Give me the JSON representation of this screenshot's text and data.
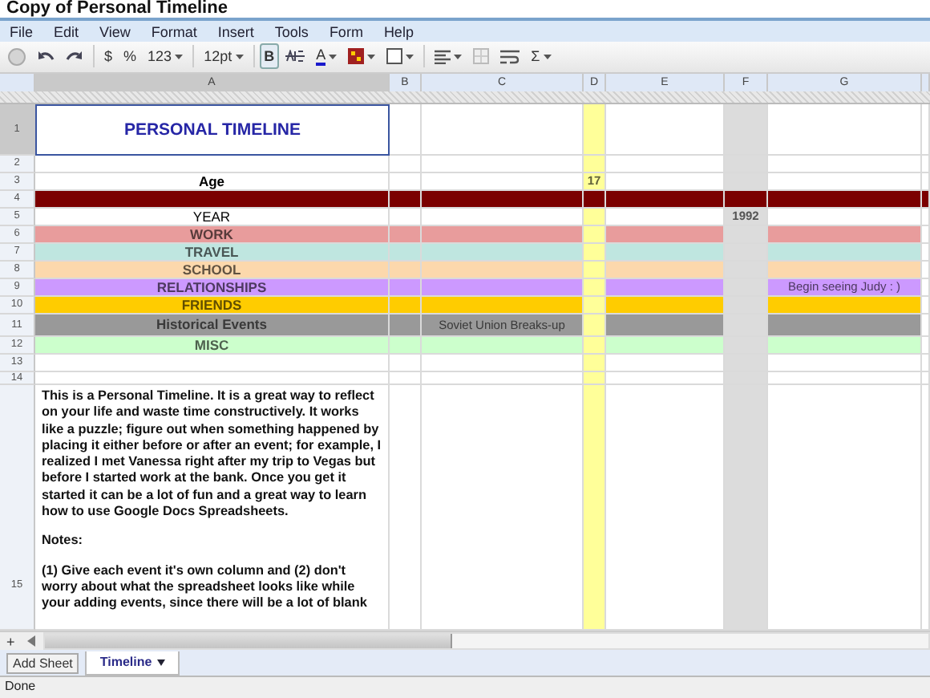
{
  "window": {
    "title": "Copy of Personal Timeline"
  },
  "menu": [
    "File",
    "Edit",
    "View",
    "Format",
    "Insert",
    "Tools",
    "Form",
    "Help"
  ],
  "toolbar": [
    {
      "kind": "print",
      "has_menu": false
    },
    {
      "kind": "undo",
      "has_menu": false
    },
    {
      "kind": "redo",
      "has_menu": false
    },
    {
      "kind": "text",
      "label": "$",
      "has_menu": false,
      "selected": false
    },
    {
      "kind": "text",
      "label": "%",
      "has_menu": false,
      "selected": false
    },
    {
      "kind": "text",
      "label": "123",
      "has_menu": true,
      "selected": false
    },
    {
      "kind": "text",
      "label": "12pt",
      "has_menu": true,
      "selected": false
    },
    {
      "kind": "text",
      "label": "B",
      "has_menu": false,
      "selected": true
    },
    {
      "kind": "strike",
      "has_menu": false
    },
    {
      "kind": "text-color",
      "label": "A",
      "has_menu": true
    },
    {
      "kind": "fill",
      "has_menu": true
    },
    {
      "kind": "borders",
      "has_menu": true
    },
    {
      "kind": "align",
      "has_menu": true
    },
    {
      "kind": "merge",
      "has_menu": false
    },
    {
      "kind": "wrap",
      "has_menu": false
    },
    {
      "kind": "text",
      "label": "Σ",
      "has_menu": true,
      "selected": false
    }
  ],
  "columns": [
    {
      "letter": "A",
      "selected": true
    },
    {
      "letter": "B",
      "selected": false
    },
    {
      "letter": "C",
      "selected": false
    },
    {
      "letter": "D",
      "selected": false,
      "color": "#ffff99"
    },
    {
      "letter": "E",
      "selected": false
    },
    {
      "letter": "F",
      "selected": false,
      "color": "#dcdcdc"
    },
    {
      "letter": "G",
      "selected": false
    }
  ],
  "rows": [
    {
      "number": "1",
      "kind": "title",
      "selected": true,
      "cells": {
        "A": {
          "text": "PERSONAL TIMELINE",
          "bold": true
        }
      }
    },
    {
      "number": "2",
      "kind": "blank",
      "selected": false
    },
    {
      "number": "3",
      "kind": "label",
      "selected": false,
      "cells": {
        "A": {
          "text": "Age",
          "bold": true
        },
        "D": {
          "text": "17",
          "bold": true
        }
      }
    },
    {
      "number": "4",
      "kind": "band",
      "selected": false,
      "color": "#7b0000"
    },
    {
      "number": "5",
      "kind": "label",
      "selected": false,
      "cells": {
        "A": {
          "text": "YEAR",
          "bold": false
        },
        "F": {
          "text": "1992",
          "bold": true
        }
      }
    },
    {
      "number": "6",
      "kind": "label",
      "selected": false,
      "color": "#e89c9c",
      "cells": {
        "A": {
          "text": "WORK",
          "bold": true
        }
      }
    },
    {
      "number": "7",
      "kind": "label",
      "selected": false,
      "color": "#bfe6e0",
      "cells": {
        "A": {
          "text": "TRAVEL",
          "bold": true
        }
      }
    },
    {
      "number": "8",
      "kind": "label",
      "selected": false,
      "color": "#fcd8ac",
      "cells": {
        "A": {
          "text": "SCHOOL",
          "bold": true
        }
      }
    },
    {
      "number": "9",
      "kind": "label",
      "selected": false,
      "color": "#cc99ff",
      "cells": {
        "A": {
          "text": "RELATIONSHIPS",
          "bold": true
        },
        "G": {
          "text": "Begin seeing Judy : )",
          "bold": false
        }
      }
    },
    {
      "number": "10",
      "kind": "label",
      "selected": false,
      "color": "#ffcc00",
      "cells": {
        "A": {
          "text": "FRIENDS",
          "bold": true
        }
      }
    },
    {
      "number": "11",
      "kind": "label",
      "selected": false,
      "color": "#999999",
      "cells": {
        "A": {
          "text": "Historical Events",
          "bold": true
        },
        "C": {
          "text": "Soviet Union Breaks-up",
          "bold": false
        }
      }
    },
    {
      "number": "12",
      "kind": "label",
      "selected": false,
      "color": "#ccffcc",
      "cells": {
        "A": {
          "text": "MISC",
          "bold": true
        }
      }
    },
    {
      "number": "13",
      "kind": "blank",
      "selected": false
    },
    {
      "number": "14",
      "kind": "blank",
      "selected": false
    },
    {
      "number": "15",
      "kind": "note",
      "selected": false,
      "cells": {
        "A": {
          "paragraphs": [
            "This is a Personal Timeline. It is a great way to reflect on your life and waste time constructively. It works like a puzzle; figure out when something happened by placing it either before or after an event; for example, I realized I met Vanessa right after my trip to Vegas but before I started work at the bank. Once you get it started it can be a lot of fun and a great way to learn how to use Google Docs Spreadsheets.",
            "Notes:",
            "(1) Give each event it's own column and (2) don't worry about what the spreadsheet looks like while your adding events, since there will be a lot of blank"
          ],
          "bold": true
        }
      }
    }
  ],
  "add_button": "+",
  "add_sheet": "Add Sheet",
  "sheet_tabs": [
    {
      "label": "Timeline",
      "selected": true
    }
  ],
  "status_bar": "Done"
}
